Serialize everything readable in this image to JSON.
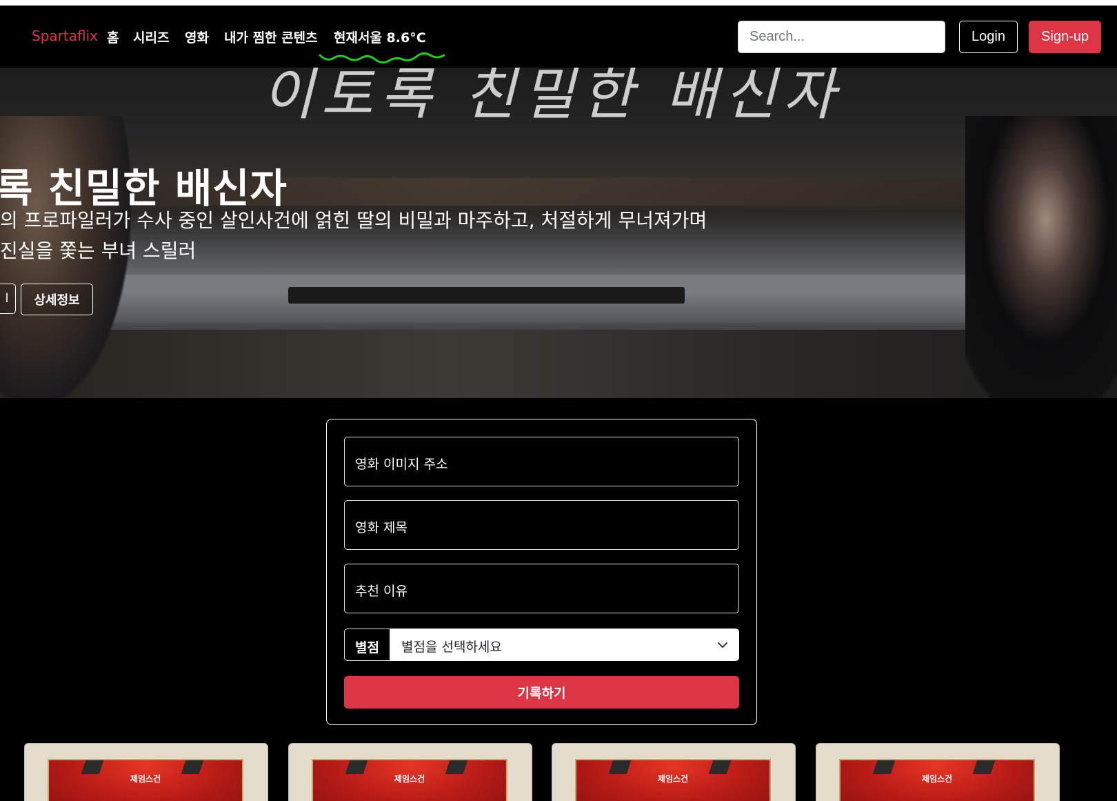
{
  "nav": {
    "brand": "Spartaflix",
    "items": [
      "홈",
      "시리즈",
      "영화",
      "내가 찜한 콘텐츠"
    ],
    "weather": "현재서울 8.6°C",
    "search_placeholder": "Search...",
    "login_label": "Login",
    "signup_label": "Sign-up"
  },
  "hero": {
    "script_text": "이토록 친밀한 배신자",
    "title": "록 친밀한 배신자",
    "description_line1": "의 프로파일러가 수사 중인 살인사건에 얽힌 딸의 비밀과 마주하고, 처절하게 무너져가며",
    "description_line2": " 진실을 쫓는 부녀 스릴러",
    "play_button_partial": "l",
    "info_button": "상세정보"
  },
  "form": {
    "image_url_label": "영화 이미지 주소",
    "title_label": "영화 제목",
    "reason_label": "추천 이유",
    "rating_label": "별점",
    "rating_value": "별점을 선택하세요",
    "submit_label": "기록하기"
  },
  "cards": [
    {
      "poster_title": "제임스건"
    },
    {
      "poster_title": "제임스건"
    },
    {
      "poster_title": "제임스건"
    },
    {
      "poster_title": "제임스건"
    }
  ],
  "colors": {
    "accent": "#dc3545",
    "background": "#000000",
    "annotation": "#22cc22"
  }
}
